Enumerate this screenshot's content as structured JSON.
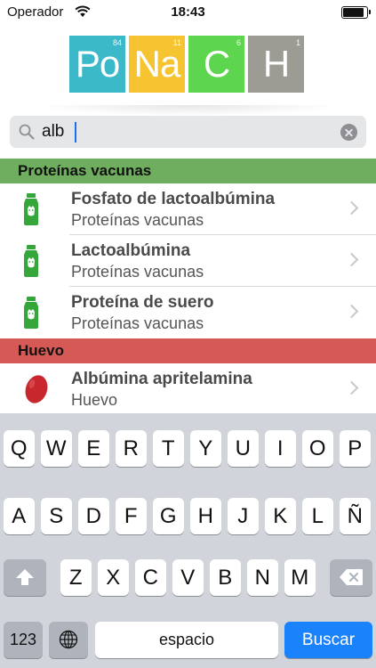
{
  "status_bar": {
    "carrier": "Operador",
    "time": "18:43",
    "battery_level": 0.92,
    "icons": [
      "wifi-icon",
      "battery-icon"
    ]
  },
  "logo": {
    "tiles": [
      {
        "symbol": "Po",
        "number": "84",
        "color": "#3bb9c9"
      },
      {
        "symbol": "Na",
        "number": "11",
        "color": "#f7c431"
      },
      {
        "symbol": "C",
        "number": "6",
        "color": "#5ed54e"
      },
      {
        "symbol": "H",
        "number": "1",
        "color": "#9c9c94"
      }
    ]
  },
  "search": {
    "value": "alb",
    "placeholder": "",
    "icons": [
      "search-icon",
      "clear-icon"
    ]
  },
  "sections": [
    {
      "title": "Proteínas vacunas",
      "color": "#6fae5f",
      "icon": "milk-bottle-icon",
      "rows": [
        {
          "title": "Fosfato de lactoalbúmina",
          "subtitle": "Proteínas vacunas"
        },
        {
          "title": "Lactoalbúmina",
          "subtitle": "Proteínas vacunas"
        },
        {
          "title": "Proteína de suero",
          "subtitle": "Proteínas vacunas"
        }
      ]
    },
    {
      "title": "Huevo",
      "color": "#d55a56",
      "icon": "egg-icon",
      "rows": [
        {
          "title": "Albúmina apritelamina",
          "subtitle": "Huevo"
        }
      ]
    }
  ],
  "keyboard": {
    "row1": [
      "Q",
      "W",
      "E",
      "R",
      "T",
      "Y",
      "U",
      "I",
      "O",
      "P"
    ],
    "row2": [
      "A",
      "S",
      "D",
      "F",
      "G",
      "H",
      "J",
      "K",
      "L",
      "Ñ"
    ],
    "row3": [
      "Z",
      "X",
      "C",
      "V",
      "B",
      "N",
      "M"
    ],
    "numbers_label": "123",
    "space_label": "espacio",
    "search_label": "Buscar",
    "icons": [
      "shift-icon",
      "backspace-icon",
      "globe-icon"
    ]
  }
}
